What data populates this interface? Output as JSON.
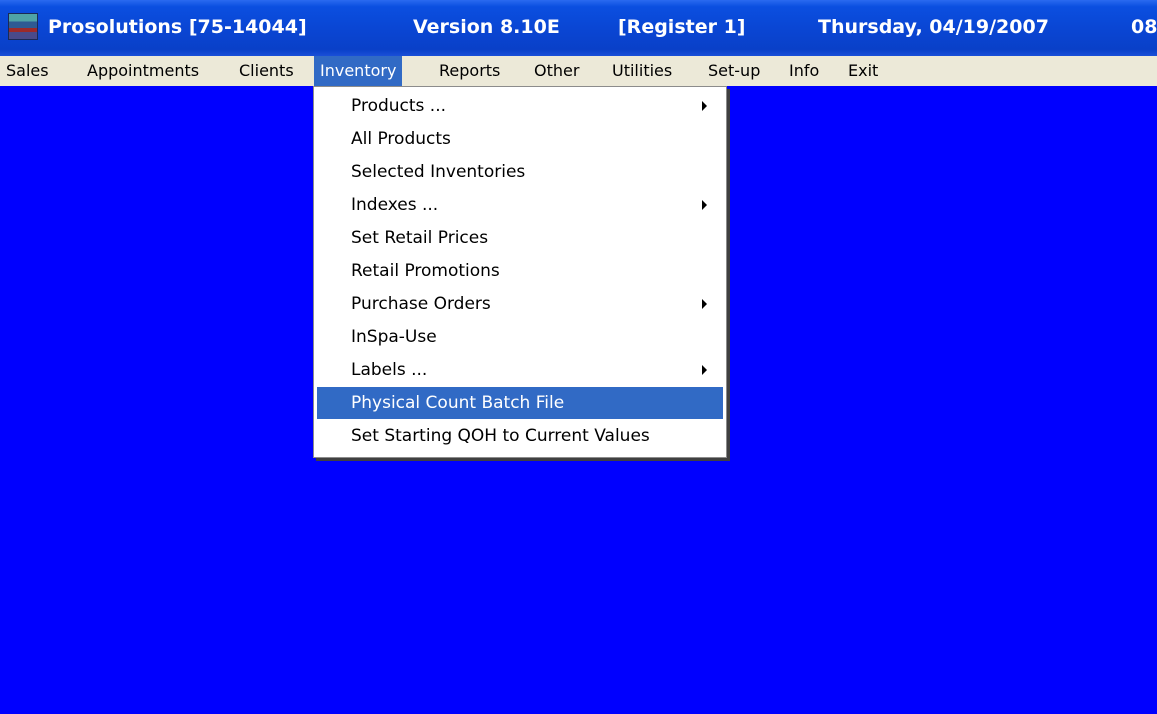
{
  "titlebar": {
    "app_name": "Prosolutions [75-14044]",
    "version": "Version 8.10E",
    "register": "[Register 1]",
    "date": "Thursday, 04/19/2007",
    "time_partial": "08"
  },
  "menubar": {
    "items": [
      {
        "label": "Sales"
      },
      {
        "label": "Appointments"
      },
      {
        "label": "Clients"
      },
      {
        "label": "Inventory",
        "active": true
      },
      {
        "label": "Reports"
      },
      {
        "label": "Other"
      },
      {
        "label": "Utilities"
      },
      {
        "label": "Set-up"
      },
      {
        "label": "Info"
      },
      {
        "label": "Exit"
      }
    ]
  },
  "inventory_menu": {
    "items": [
      {
        "label": "Products ...",
        "submenu": true
      },
      {
        "label": "All Products"
      },
      {
        "label": "Selected Inventories"
      },
      {
        "label": "Indexes ...",
        "submenu": true
      },
      {
        "label": "Set Retail Prices"
      },
      {
        "label": "Retail Promotions"
      },
      {
        "label": "Purchase Orders",
        "submenu": true
      },
      {
        "label": "InSpa-Use"
      },
      {
        "label": "Labels ...",
        "submenu": true
      },
      {
        "label": "Physical Count Batch File",
        "highlighted": true
      },
      {
        "label": "Set Starting QOH to Current Values"
      }
    ]
  },
  "colors": {
    "desktop": "#0000ff",
    "menubar": "#ece9d8",
    "highlight": "#316ac5",
    "titlebar": "#0a46d4"
  }
}
